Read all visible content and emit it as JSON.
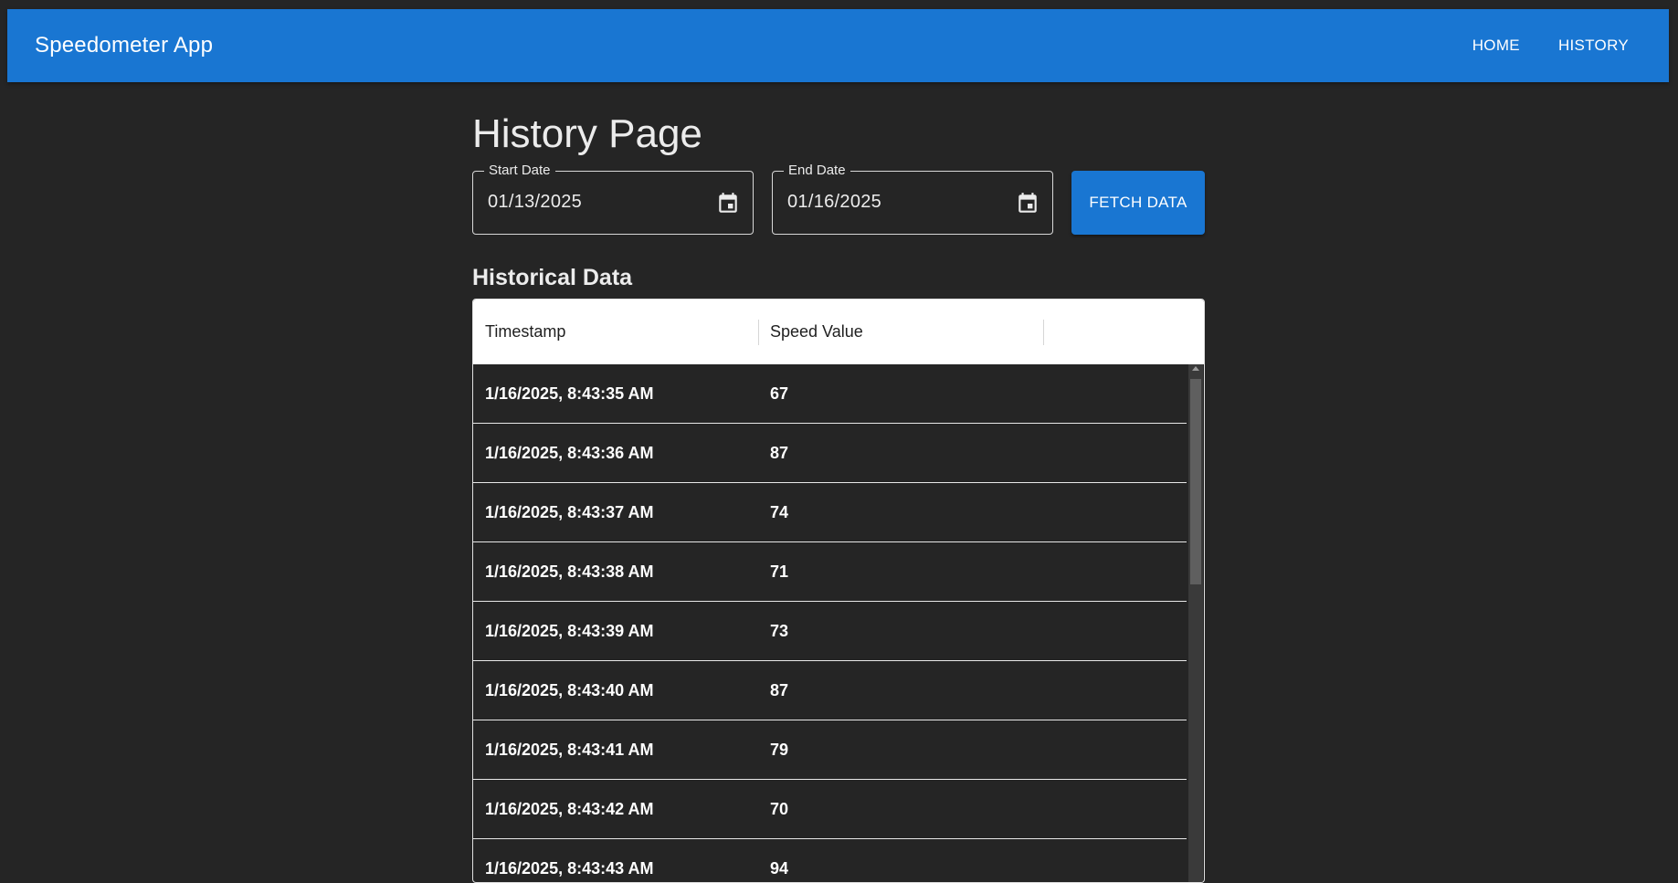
{
  "app": {
    "title": "Speedometer App"
  },
  "nav": {
    "home": "HOME",
    "history": "HISTORY"
  },
  "page": {
    "title": "History Page"
  },
  "filters": {
    "start_label": "Start Date",
    "start_value": "01/13/2025",
    "end_label": "End Date",
    "end_value": "01/16/2025",
    "fetch_label": "FETCH DATA"
  },
  "section": {
    "title": "Historical Data"
  },
  "table": {
    "columns": [
      "Timestamp",
      "Speed Value"
    ],
    "rows": [
      {
        "timestamp": "1/16/2025, 8:43:35 AM",
        "speed": "67"
      },
      {
        "timestamp": "1/16/2025, 8:43:36 AM",
        "speed": "87"
      },
      {
        "timestamp": "1/16/2025, 8:43:37 AM",
        "speed": "74"
      },
      {
        "timestamp": "1/16/2025, 8:43:38 AM",
        "speed": "71"
      },
      {
        "timestamp": "1/16/2025, 8:43:39 AM",
        "speed": "73"
      },
      {
        "timestamp": "1/16/2025, 8:43:40 AM",
        "speed": "87"
      },
      {
        "timestamp": "1/16/2025, 8:43:41 AM",
        "speed": "79"
      },
      {
        "timestamp": "1/16/2025, 8:43:42 AM",
        "speed": "70"
      },
      {
        "timestamp": "1/16/2025, 8:43:43 AM",
        "speed": "94"
      }
    ]
  },
  "icons": {
    "calendar": "calendar-icon"
  },
  "colors": {
    "primary": "#1976d2",
    "background": "#252525",
    "text": "#ececec"
  }
}
